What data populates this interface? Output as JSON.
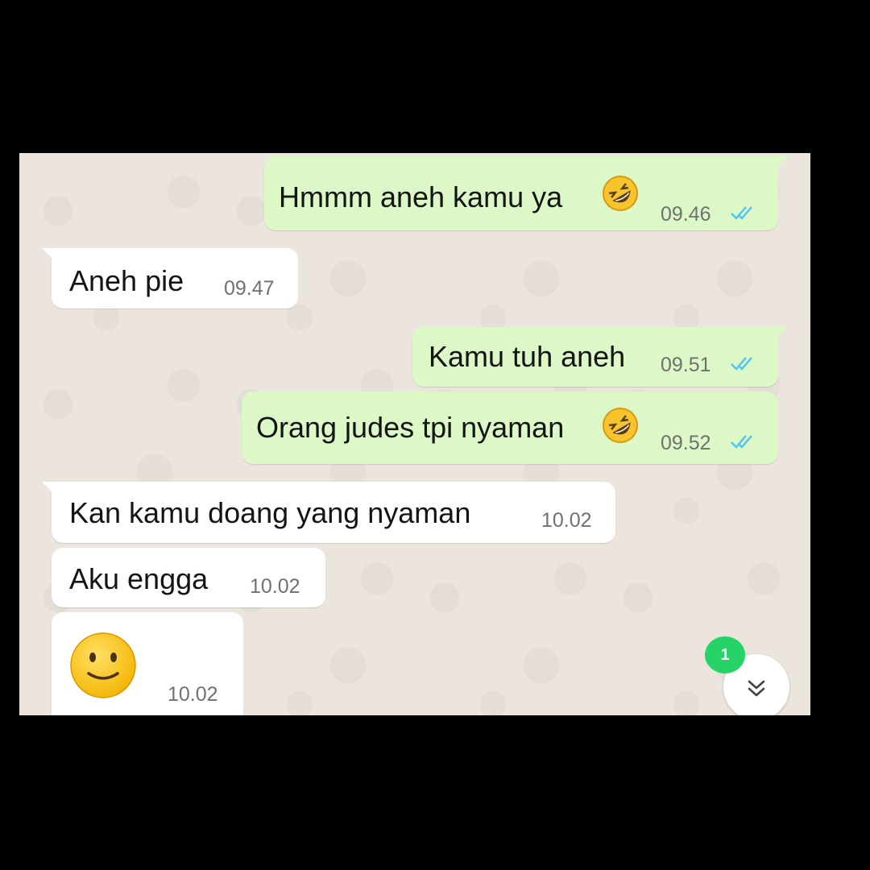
{
  "colors": {
    "outgoing_bubble": "#dcf8c6",
    "incoming_bubble": "#ffffff",
    "read_ticks": "#4fc3f7",
    "badge": "#25d366"
  },
  "messages": [
    {
      "direction": "outgoing",
      "text": "Hmmm aneh kamu ya",
      "emoji": "rolling-on-floor-laughing-icon",
      "time": "09.46",
      "status": "read"
    },
    {
      "direction": "incoming",
      "text": "Aneh pie",
      "time": "09.47"
    },
    {
      "direction": "outgoing",
      "text": "Kamu tuh aneh",
      "time": "09.51",
      "status": "read"
    },
    {
      "direction": "outgoing",
      "text": "Orang judes tpi nyaman",
      "emoji": "rolling-on-floor-laughing-icon",
      "time": "09.52",
      "status": "read"
    },
    {
      "direction": "incoming",
      "text": "Kan kamu doang yang nyaman",
      "time": "10.02"
    },
    {
      "direction": "incoming",
      "text": "Aku engga",
      "time": "10.02"
    },
    {
      "direction": "incoming",
      "text": "",
      "emoji": "slightly-smiling-face-icon",
      "time": "10.02"
    }
  ],
  "unread_badge": {
    "count": "1"
  },
  "scroll_button": {
    "icon": "double-chevron-down-icon"
  }
}
